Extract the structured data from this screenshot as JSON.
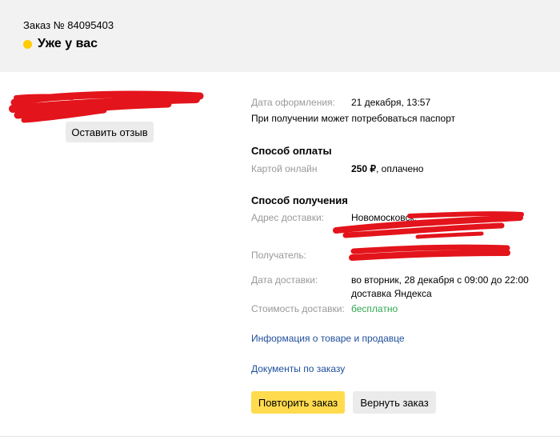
{
  "header": {
    "order_number": "Заказ № 84095403",
    "status": "Уже у вас"
  },
  "left": {
    "review_button": "Оставить отзыв"
  },
  "details": {
    "order_date_label": "Дата оформления:",
    "order_date_value": "21 декабря, 13:57",
    "passport_note": "При получении может потребоваться паспорт",
    "payment": {
      "title": "Способ оплаты",
      "method_label": "Картой онлайн",
      "amount": "250 ₽",
      "amount_status": ", оплачено"
    },
    "delivery": {
      "title": "Способ получения",
      "address_label": "Адрес доставки:",
      "address_value": "Новомосковск,",
      "recipient_label": "Получатель:",
      "date_label": "Дата доставки:",
      "date_value": "во вторник, 28 декабря с 09:00 до 22:00",
      "service_value": "доставка Яндекса",
      "cost_label": "Стоимость доставки:",
      "cost_value": "бесплатно"
    },
    "links": {
      "product_info": "Информация о товаре и продавце",
      "documents": "Документы по заказу"
    },
    "buttons": {
      "repeat": "Повторить заказ",
      "return": "Вернуть заказ"
    }
  },
  "colors": {
    "header_bg": "#f2f2f2",
    "status_dot": "#ffcc00",
    "primary_button": "#ffdb4d",
    "secondary_button": "#ebebeb",
    "link": "#1f4e9a",
    "free_text": "#2fa84f",
    "redaction": "#e3141b"
  }
}
